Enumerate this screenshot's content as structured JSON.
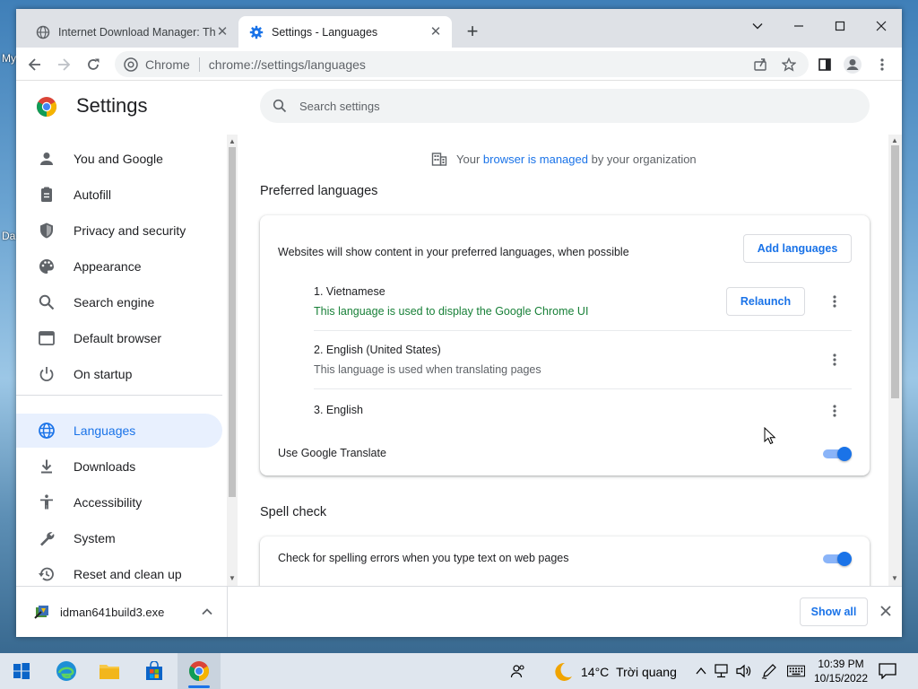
{
  "desktop": {
    "label_top": "My",
    "label_bottom": "Da"
  },
  "tabs": [
    {
      "title": "Internet Download Manager: The",
      "active": false
    },
    {
      "title": "Settings - Languages",
      "active": true
    }
  ],
  "omnibox": {
    "origin": "Chrome",
    "url": "chrome://settings/languages"
  },
  "settings": {
    "title": "Settings",
    "search_placeholder": "Search settings",
    "sidebar": [
      {
        "label": "You and Google",
        "icon": "person-icon"
      },
      {
        "label": "Autofill",
        "icon": "clipboard-icon"
      },
      {
        "label": "Privacy and security",
        "icon": "shield-icon"
      },
      {
        "label": "Appearance",
        "icon": "palette-icon"
      },
      {
        "label": "Search engine",
        "icon": "search-icon"
      },
      {
        "label": "Default browser",
        "icon": "browser-icon"
      },
      {
        "label": "On startup",
        "icon": "power-icon"
      },
      {
        "label": "Languages",
        "icon": "globe-icon",
        "active": true
      },
      {
        "label": "Downloads",
        "icon": "download-icon"
      },
      {
        "label": "Accessibility",
        "icon": "accessibility-icon"
      },
      {
        "label": "System",
        "icon": "wrench-icon"
      },
      {
        "label": "Reset and clean up",
        "icon": "reset-icon"
      }
    ],
    "managed": {
      "prefix": "Your",
      "link": "browser is managed",
      "suffix": "by your organization"
    },
    "preferred": {
      "title": "Preferred languages",
      "description": "Websites will show content in your preferred languages, when possible",
      "add_button": "Add languages",
      "languages": [
        {
          "name": "1. Vietnamese",
          "note": "This language is used to display the Google Chrome UI",
          "action": "Relaunch"
        },
        {
          "name": "2. English (United States)",
          "note": "This language is used when translating pages"
        },
        {
          "name": "3. English",
          "note": ""
        }
      ],
      "translate_label": "Use Google Translate",
      "translate_on": true
    },
    "spell": {
      "title": "Spell check",
      "check_label": "Check for spelling errors when you type text on web pages",
      "check_on": true
    }
  },
  "downloads": {
    "file": "idman641build3.exe",
    "show_all": "Show all"
  },
  "taskbar": {
    "weather_temp": "14°C",
    "weather_text": "Trời quang",
    "time": "10:39 PM",
    "date": "10/15/2022"
  },
  "colors": {
    "accent": "#1a73e8",
    "success": "#188038"
  }
}
